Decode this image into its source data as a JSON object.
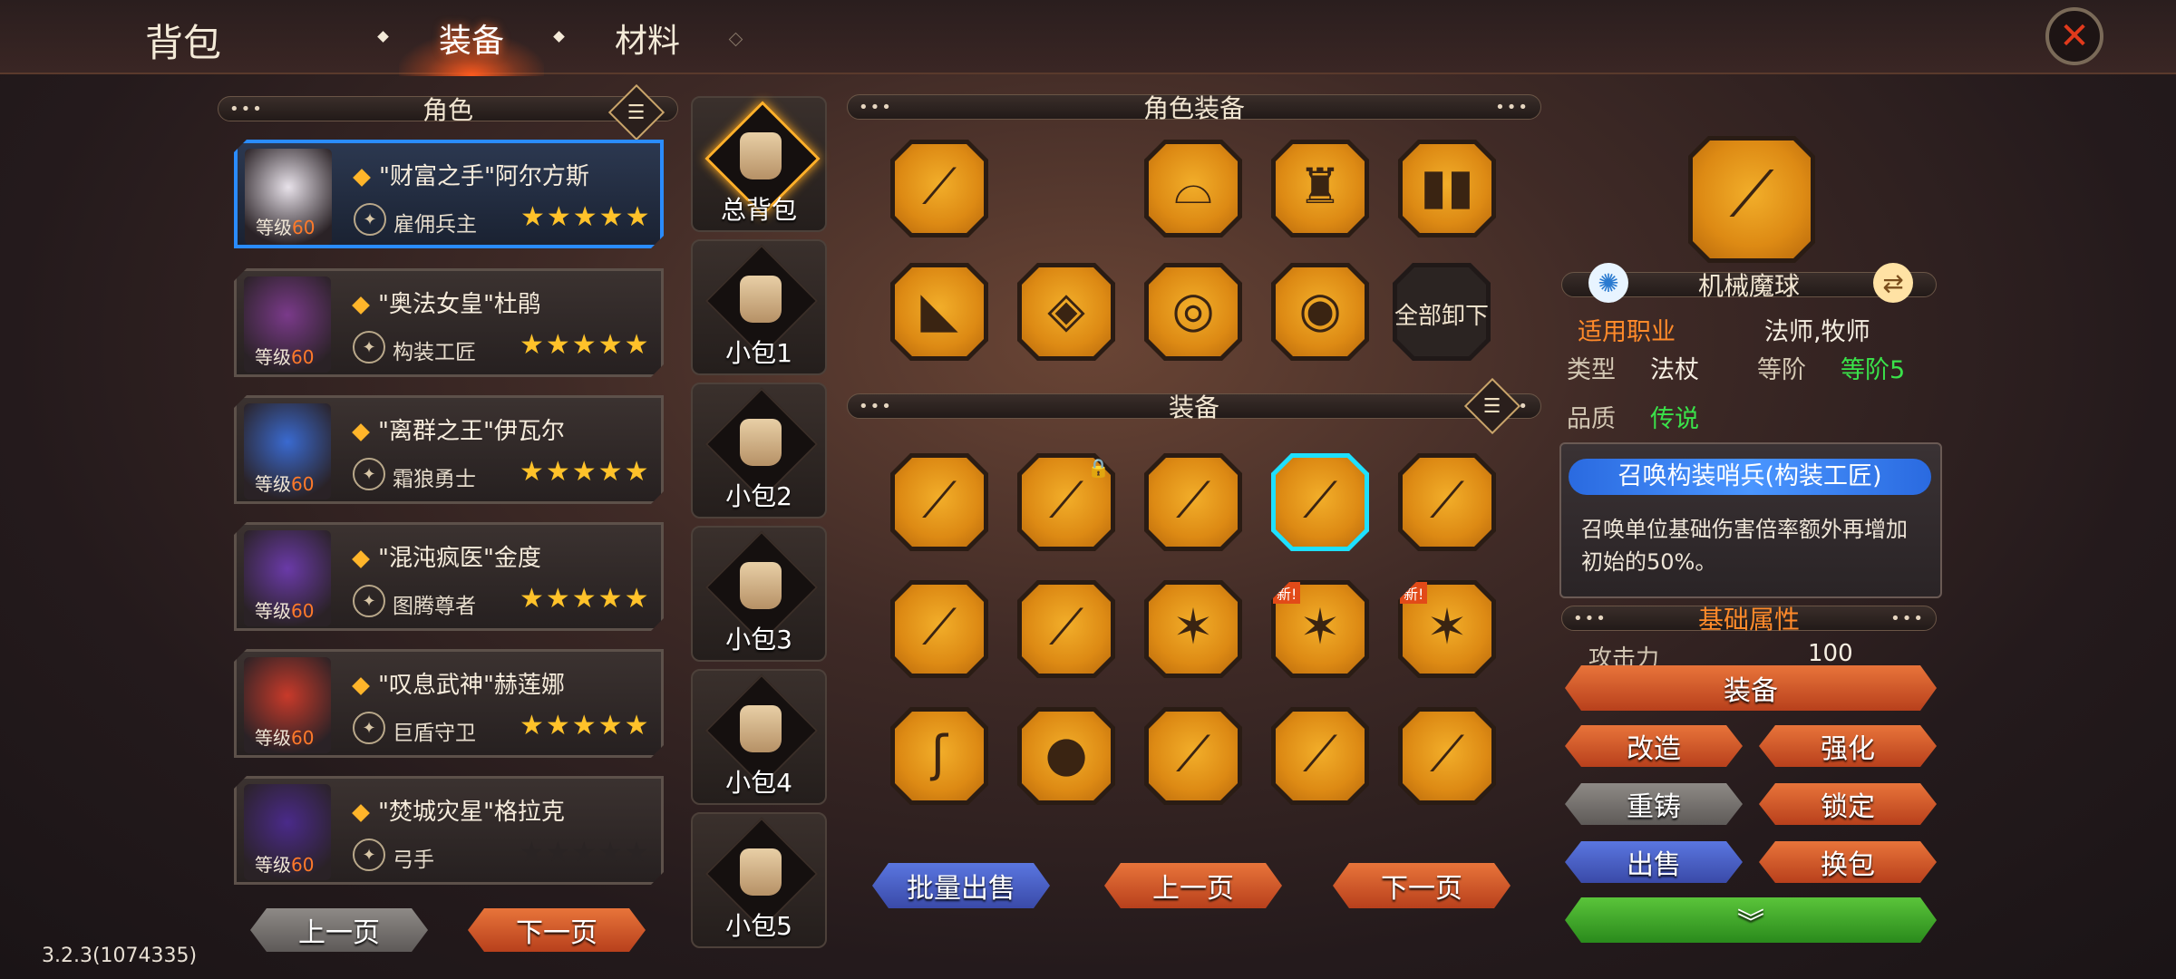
{
  "header": {
    "title": "背包",
    "tabs": [
      {
        "label": "装备",
        "active": true
      },
      {
        "label": "材料",
        "active": false
      }
    ],
    "close_icon": "close-icon"
  },
  "left": {
    "section_title": "角色",
    "characters": [
      {
        "name": "\"财富之手\"阿尔方斯",
        "class": "雇佣兵主",
        "level_label": "等级",
        "level": "60",
        "stars": "★★★★★",
        "selected": true,
        "color": "#e8e2ea"
      },
      {
        "name": "\"奥法女皇\"杜鹃",
        "class": "构装工匠",
        "level_label": "等级",
        "level": "60",
        "stars": "★★★★★",
        "selected": false,
        "color": "#7a3a8a"
      },
      {
        "name": "\"离群之王\"伊瓦尔",
        "class": "霜狼勇士",
        "level_label": "等级",
        "level": "60",
        "stars": "★★★★★",
        "selected": false,
        "color": "#3a6ad0"
      },
      {
        "name": "\"混沌疯医\"金度",
        "class": "图腾尊者",
        "level_label": "等级",
        "level": "60",
        "stars": "★★★★★",
        "selected": false,
        "color": "#6a3aa8"
      },
      {
        "name": "\"叹息武神\"赫莲娜",
        "class": "巨盾守卫",
        "level_label": "等级",
        "level": "60",
        "stars": "★★★★★",
        "selected": false,
        "color": "#c83a2a"
      },
      {
        "name": "\"焚城灾星\"格拉克",
        "class": "弓手",
        "level_label": "等级",
        "level": "60",
        "stars": "★★★★★",
        "selected": false,
        "dim": true,
        "color": "#4a2a8a"
      }
    ],
    "prev_label": "上一页",
    "next_label": "下一页"
  },
  "bags": [
    {
      "label": "总背包",
      "selected": true
    },
    {
      "label": "小包1"
    },
    {
      "label": "小包2"
    },
    {
      "label": "小包3"
    },
    {
      "label": "小包4"
    },
    {
      "label": "小包5"
    }
  ],
  "middle": {
    "char_equip_title": "角色装备",
    "unequip_all_label": "全部卸下",
    "equip_title": "装备",
    "char_slots": [
      {
        "icon": "staff-icon",
        "glyph": "⟋"
      },
      {
        "icon": "empty-slot"
      },
      {
        "icon": "hat-icon",
        "glyph": "⌓"
      },
      {
        "icon": "robe-icon",
        "glyph": "♜"
      },
      {
        "icon": "greaves-icon",
        "glyph": "▮▮"
      },
      {
        "icon": "boots-icon",
        "glyph": "◣"
      },
      {
        "icon": "necklace-icon",
        "glyph": "◈"
      },
      {
        "icon": "ring-icon",
        "glyph": "◎"
      },
      {
        "icon": "ring-icon",
        "glyph": "◉"
      }
    ],
    "items": [
      {
        "icon": "staff-icon",
        "glyph": "⟋"
      },
      {
        "icon": "staff-icon",
        "glyph": "⟋",
        "locked": true
      },
      {
        "icon": "staff-icon",
        "glyph": "⟋"
      },
      {
        "icon": "staff-icon",
        "glyph": "⟋",
        "selected": true
      },
      {
        "icon": "staff-icon",
        "glyph": "⟋"
      },
      {
        "icon": "wand-icon",
        "glyph": "⟋"
      },
      {
        "icon": "wand-icon",
        "glyph": "⟋"
      },
      {
        "icon": "star-staff-icon",
        "glyph": "✶"
      },
      {
        "icon": "star-staff-icon",
        "glyph": "✶",
        "new": "新!"
      },
      {
        "icon": "star-staff-icon",
        "glyph": "✶",
        "new": "新!"
      },
      {
        "icon": "crook-icon",
        "glyph": "ʃ"
      },
      {
        "icon": "orb-staff-icon",
        "glyph": "●"
      },
      {
        "icon": "branch-staff-icon",
        "glyph": "⟋"
      },
      {
        "icon": "staff-icon",
        "glyph": "⟋"
      },
      {
        "icon": "staff-icon",
        "glyph": "⟋"
      }
    ],
    "bulk_sell_label": "批量出售",
    "prev_label": "上一页",
    "next_label": "下一页"
  },
  "item": {
    "name": "机械魔球",
    "job_label": "适用职业",
    "job_value": "法师,牧师",
    "type_label": "类型",
    "type_value": "法杖",
    "tier_label": "等阶",
    "tier_value": "等阶5",
    "quality_label": "品质",
    "quality_value": "传说",
    "skill_title": "召唤构装哨兵(构装工匠)",
    "skill_desc": "召唤单位基础伤害倍率额外再增加初始的50%。",
    "base_attr_title": "基础属性",
    "attr_label": "攻击力",
    "attr_value": "100"
  },
  "actions": {
    "equip": "装备",
    "modify": "改造",
    "enhance": "强化",
    "reforge": "重铸",
    "lock": "锁定",
    "sell": "出售",
    "swap_bag": "换包",
    "more_icon": "chevron-down-icon"
  },
  "version": "3.2.3(1074335)",
  "colors": {
    "accent_orange": "#e8743a",
    "select_blue": "#2a8cff",
    "legendary_green": "#3ae24a",
    "slot_gold": "#f2ae2a"
  }
}
